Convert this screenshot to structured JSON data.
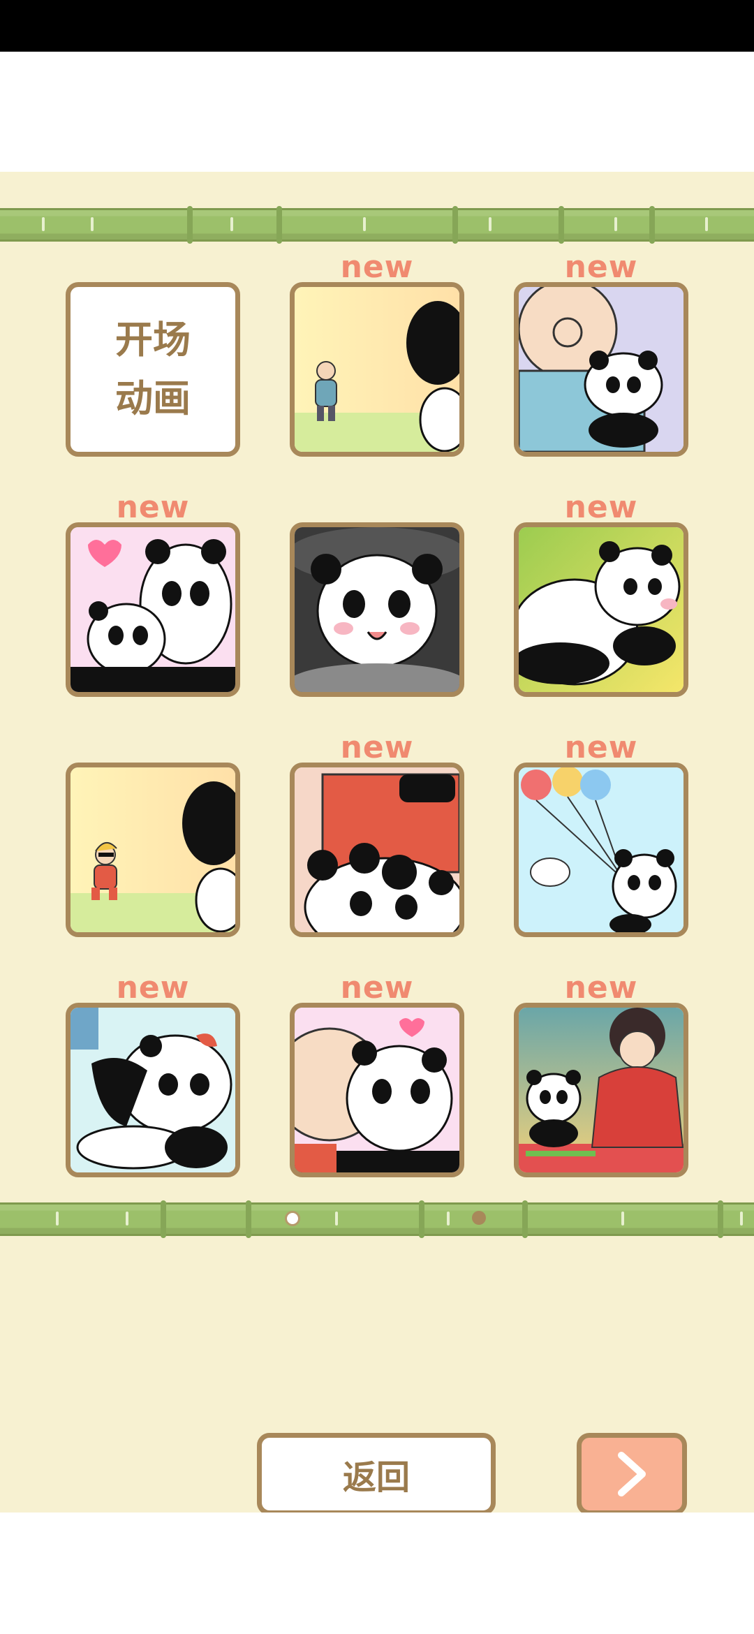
{
  "intro_tile_label": "开场\n动画",
  "new_badge": "new",
  "tiles": [
    {
      "id": "intro",
      "new": false
    },
    {
      "id": "grandpa-waving",
      "new": true
    },
    {
      "id": "grandpa-hugging-panda",
      "new": true
    },
    {
      "id": "panda-heart-hug",
      "new": true
    },
    {
      "id": "panda-in-pot",
      "new": false
    },
    {
      "id": "panda-lying-grass",
      "new": true
    },
    {
      "id": "sunglasses-kid-waving",
      "new": false
    },
    {
      "id": "red-jacket-with-panda",
      "new": true
    },
    {
      "id": "panda-balloons",
      "new": true
    },
    {
      "id": "panda-crying",
      "new": true
    },
    {
      "id": "panda-kissed",
      "new": true
    },
    {
      "id": "kimono-girl-panda",
      "new": true
    }
  ],
  "pagination": {
    "current": 1,
    "total": 2
  },
  "buttons": {
    "back_label": "返回",
    "next_icon": "chevron-right-icon"
  },
  "colors": {
    "background": "#f7f1d1",
    "frame": "#a8885a",
    "new_text": "#f08a70",
    "next_button": "#f9b193",
    "bamboo": "#9cc06a"
  }
}
